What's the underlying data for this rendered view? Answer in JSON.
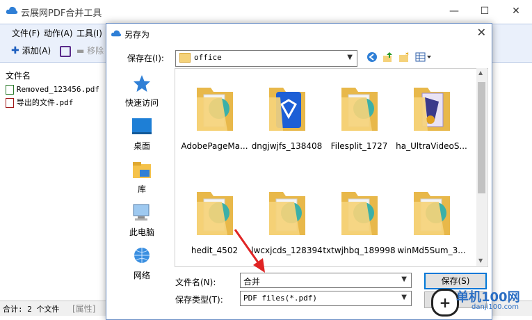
{
  "app": {
    "title": "云展网PDF合并工具",
    "menu": [
      "文件(F)",
      "动作(A)",
      "工具(I)"
    ],
    "toolbar": {
      "add_label": "添加(A)",
      "remove_label": "移除"
    },
    "list_header": "文件名",
    "files": [
      "Removed_123456.pdf",
      "导出的文件.pdf"
    ],
    "status": {
      "total": "合计: 2 个文件",
      "properties": "[属性]"
    }
  },
  "dialog": {
    "title": "另存为",
    "save_in_label": "保存在(I):",
    "location": "office",
    "places": [
      "快速访问",
      "桌面",
      "库",
      "此电脑",
      "网络"
    ],
    "items": [
      "AdobePageMa...",
      "dngjwjfs_138408",
      "Filesplit_1727",
      "ha_UltraVideoS...",
      "hedit_4502",
      "lwcxjcds_128394",
      "txtwjhbq_189998",
      "winMd5Sum_3..."
    ],
    "filename_label": "文件名(N):",
    "filename_value": "合并",
    "filetype_label": "保存类型(T):",
    "filetype_value": "PDF files(*.pdf)",
    "save_button": "保存(S)"
  },
  "watermark": {
    "site_name": "单机100网",
    "site_url": "danji100.com"
  },
  "colors": {
    "accent": "#0078d7",
    "folder": "#f5d27a",
    "arrow": "#e02424",
    "menubar": "#eaf0fb"
  }
}
